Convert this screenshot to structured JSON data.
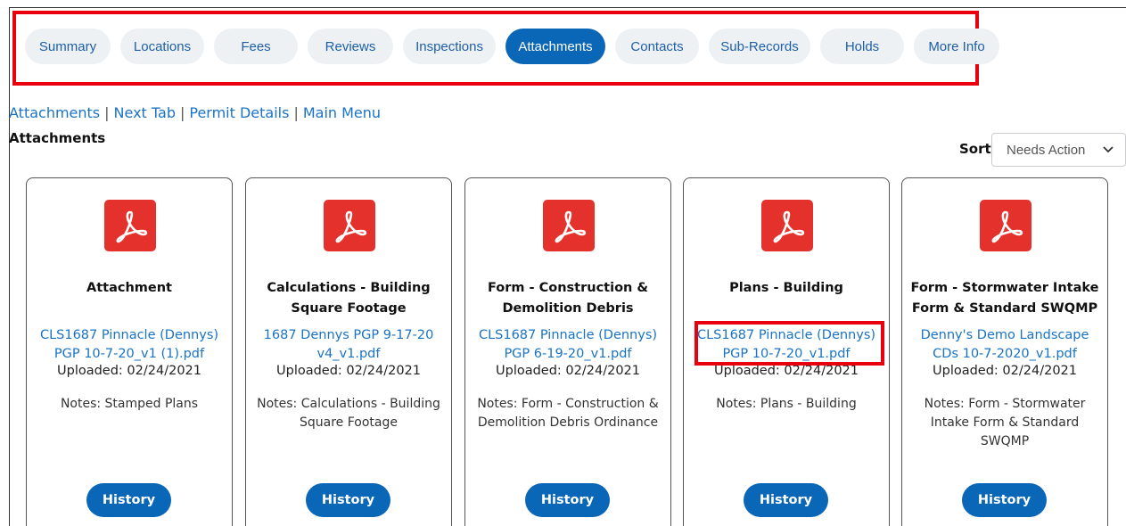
{
  "tabs": [
    {
      "label": "Summary"
    },
    {
      "label": "Locations"
    },
    {
      "label": "Fees"
    },
    {
      "label": "Reviews"
    },
    {
      "label": "Inspections"
    },
    {
      "label": "Attachments"
    },
    {
      "label": "Contacts"
    },
    {
      "label": "Sub-Records"
    },
    {
      "label": "Holds"
    },
    {
      "label": "More Info"
    }
  ],
  "active_tab": "Attachments",
  "nav_links": {
    "attachments": "Attachments",
    "next_tab": "Next Tab",
    "permit_details": "Permit Details",
    "main_menu": "Main Menu",
    "separator": "|"
  },
  "section_title": "Attachments",
  "sort": {
    "label": "Sort",
    "selected": "Needs Action"
  },
  "cards": [
    {
      "title": "Attachment",
      "file": "CLS1687 Pinnacle (Dennys) PGP 10-7-20_v1 (1).pdf",
      "uploaded": "Uploaded: 02/24/2021",
      "notes": "Notes: Stamped Plans",
      "button": "History"
    },
    {
      "title": "Calculations - Building Square Footage",
      "file": "1687 Dennys PGP 9-17-20 v4_v1.pdf",
      "uploaded": "Uploaded: 02/24/2021",
      "notes": "Notes: Calculations - Building Square Footage",
      "button": "History"
    },
    {
      "title": "Form - Construction & Demolition Debris",
      "file": "CLS1687 Pinnacle (Dennys) PGP 6-19-20_v1.pdf",
      "uploaded": "Uploaded: 02/24/2021",
      "notes": "Notes: Form - Construction & Demolition Debris Ordinance",
      "button": "History"
    },
    {
      "title": "Plans - Building",
      "file": "CLS1687 Pinnacle (Dennys) PGP 10-7-20_v1.pdf",
      "uploaded": "Uploaded: 02/24/2021",
      "notes": "Notes: Plans - Building",
      "button": "History"
    },
    {
      "title": "Form - Stormwater Intake Form & Standard SWQMP",
      "file": "Denny's Demo Landscape CDs 10-7-2020_v1.pdf",
      "uploaded": "Uploaded: 02/24/2021",
      "notes": "Notes: Form - Stormwater Intake Form & Standard SWQMP",
      "button": "History"
    }
  ],
  "icons": {
    "file_type": "pdf-icon",
    "sort_chevron": "chevron-down-icon"
  },
  "colors": {
    "accent": "#0a66b7",
    "link": "#1a73c5",
    "pdf_red": "#e5312b",
    "highlight_red": "#e8000f",
    "tab_bg": "#eef1f4"
  }
}
